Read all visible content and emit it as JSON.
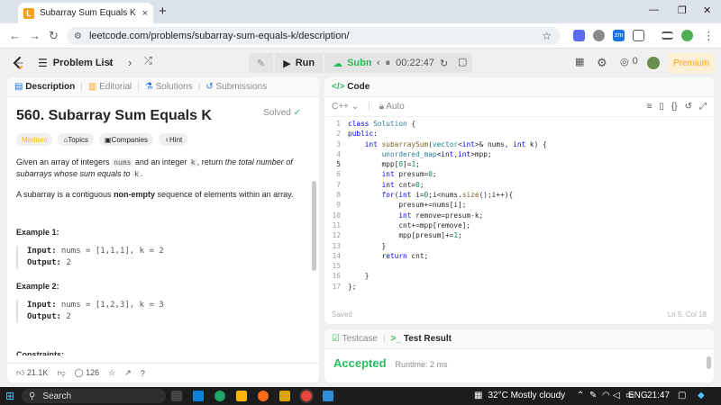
{
  "browser": {
    "tab_title": "Subarray Sum Equals K - LeetC",
    "tab_close": "×",
    "new_tab": "+",
    "url": "leetcode.com/problems/subarray-sum-equals-k/description/",
    "win_min": "—",
    "win_max": "❐",
    "win_close": "✕",
    "profile_badge": "zm"
  },
  "lc_header": {
    "problem_list": "Problem List",
    "run": "Run",
    "submit": "Submit",
    "timer": "00:22:47",
    "coins": "0",
    "premium": "Premium"
  },
  "left_panel": {
    "tabs": [
      "Description",
      "Editorial",
      "Solutions",
      "Submissions"
    ],
    "title": "560. Subarray Sum Equals K",
    "solved": "Solved",
    "pills": [
      "Medium",
      "Topics",
      "Companies",
      "Hint"
    ],
    "para1_a": "Given an array of integers ",
    "para1_code1": "nums",
    "para1_b": " and an integer ",
    "para1_code2": "k",
    "para1_c": ", return ",
    "para1_em": "the total number of subarrays whose sum equals to",
    "para1_d": " ",
    "para1_code3": "k",
    "para1_e": ".",
    "para2_a": "A subarray is a contiguous ",
    "para2_b": "non-empty",
    "para2_c": " sequence of elements within an array.",
    "ex1_title": "Example 1:",
    "ex1_input_label": "Input:",
    "ex1_input": " nums = [1,1,1], k = 2",
    "ex1_output_label": "Output:",
    "ex1_output": " 2",
    "ex2_title": "Example 2:",
    "ex2_input_label": "Input:",
    "ex2_input": " nums = [1,2,3], k = 3",
    "ex2_output_label": "Output:",
    "ex2_output": " 2",
    "constraints": "Constraints:",
    "likes": "21.1K",
    "comments": "126"
  },
  "editor": {
    "tab": "Code",
    "language": "C++",
    "mode": "Auto",
    "saved": "Saved",
    "cursor": "Ln 5, Col 18",
    "lines": [
      {
        "n": "1",
        "t": "class Solution {"
      },
      {
        "n": "2",
        "t": "public:"
      },
      {
        "n": "3",
        "t": "    int subarraySum(vector<int>& nums, int k) {"
      },
      {
        "n": "4",
        "t": "        unordered_map<int,int>mpp;"
      },
      {
        "n": "5",
        "t": "        mpp[0]=1;"
      },
      {
        "n": "6",
        "t": "        int presum=0;"
      },
      {
        "n": "7",
        "t": "        int cnt=0;"
      },
      {
        "n": "8",
        "t": "        for(int i=0;i<nums.size();i++){"
      },
      {
        "n": "9",
        "t": "            presum+=nums[i];"
      },
      {
        "n": "10",
        "t": "            int remove=presum-k;"
      },
      {
        "n": "11",
        "t": "            cnt+=mpp[remove];"
      },
      {
        "n": "12",
        "t": "            mpp[presum]+=1;"
      },
      {
        "n": "13",
        "t": "        }"
      },
      {
        "n": "14",
        "t": "        return cnt;"
      },
      {
        "n": "15",
        "t": ""
      },
      {
        "n": "16",
        "t": "    }"
      },
      {
        "n": "17",
        "t": "};"
      }
    ]
  },
  "result_panel": {
    "tabs": [
      "Testcase",
      "Test Result"
    ],
    "status": "Accepted",
    "runtime": "Runtime: 2 ms"
  },
  "taskbar": {
    "search": "Search",
    "weather": "32°C  Mostly cloudy",
    "lang": "ENG",
    "time": "21:47"
  },
  "colors": {
    "accepted": "#2cbb5d",
    "medium": "#ffb800",
    "premium": "#ffa116"
  }
}
